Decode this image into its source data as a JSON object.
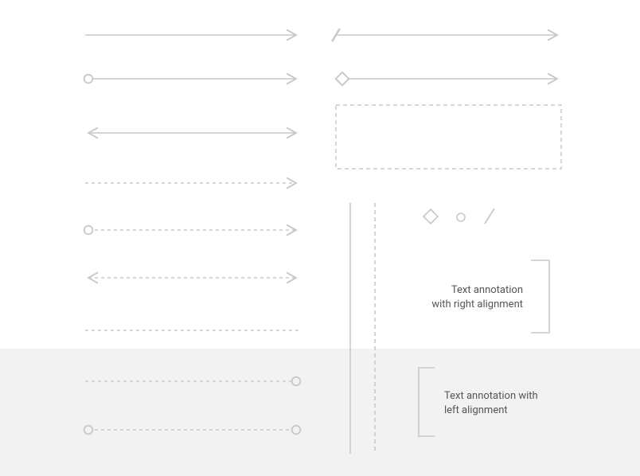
{
  "palette": {
    "stroke": "#c8c8c8",
    "text": "#555555",
    "band": "#f2f2f2"
  },
  "annotations": {
    "right": {
      "line1": "Text annotation",
      "line2": "with right alignment"
    },
    "left": {
      "line1": "Text annotation with",
      "line2": "left alignment"
    }
  },
  "marker_samples": [
    "diamond",
    "circle",
    "slash"
  ],
  "arrows_left_column": [
    {
      "id": "solid-arrow",
      "style": "solid",
      "start": "none",
      "end": "arrow"
    },
    {
      "id": "solid-arrow-circle-start",
      "style": "solid",
      "start": "circle",
      "end": "arrow"
    },
    {
      "id": "solid-double-arrow",
      "style": "solid",
      "start": "arrow",
      "end": "arrow"
    },
    {
      "id": "dashed-arrow",
      "style": "dashed",
      "start": "none",
      "end": "arrow"
    },
    {
      "id": "dashed-arrow-circle-start",
      "style": "dashed",
      "start": "circle",
      "end": "arrow"
    },
    {
      "id": "dashed-double-arrow",
      "style": "dashed",
      "start": "arrow",
      "end": "arrow"
    },
    {
      "id": "dashed-line-plain",
      "style": "dashed",
      "start": "none",
      "end": "none"
    },
    {
      "id": "dashed-line-circle-end",
      "style": "dashed",
      "start": "none",
      "end": "circle"
    },
    {
      "id": "dashed-line-circle-both",
      "style": "dashed",
      "start": "circle",
      "end": "circle"
    }
  ],
  "arrows_right_upper": [
    {
      "id": "solid-arrow-slash-start",
      "style": "solid",
      "start": "slash",
      "end": "arrow"
    },
    {
      "id": "solid-arrow-diamond-start",
      "style": "solid",
      "start": "diamond",
      "end": "arrow"
    }
  ],
  "right_elements": [
    "dashed-rectangle",
    "vertical-solid-line",
    "vertical-dashed-line",
    "marker-row",
    "right-bracket",
    "left-bracket"
  ]
}
